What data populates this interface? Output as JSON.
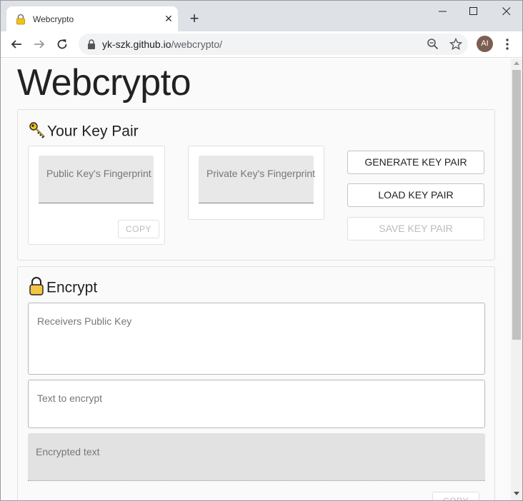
{
  "browser": {
    "tab_title": "Webcrypto",
    "tab_close": "✕",
    "new_tab": "+",
    "url_host": "yk-szk.github.io",
    "url_path": "/webcrypto/",
    "avatar_initials": "AI"
  },
  "page": {
    "title": "Webcrypto"
  },
  "key_pair": {
    "title": "Your Key Pair",
    "public_fp_label": "Public Key's Fingerprint",
    "private_fp_label": "Private Key's Fingerprint",
    "copy_label": "COPY",
    "generate_label": "GENERATE KEY PAIR",
    "load_label": "LOAD KEY PAIR",
    "save_label": "SAVE KEY PAIR"
  },
  "encrypt": {
    "title": "Encrypt",
    "receivers_key_placeholder": "Receivers Public Key",
    "text_placeholder": "Text to encrypt",
    "encrypted_placeholder": "Encrypted text",
    "copy_label": "COPY"
  },
  "colors": {
    "accent_key": "#f1c40f",
    "lock_body": "#f4c542"
  }
}
